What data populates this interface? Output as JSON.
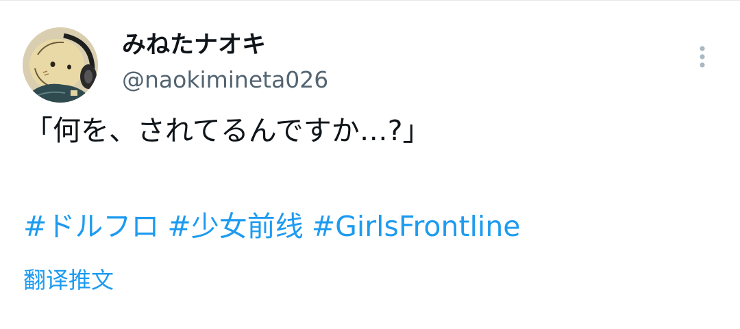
{
  "tweet": {
    "author": {
      "display_name": "みねたナオキ",
      "handle": "@naokimineta026",
      "avatar_icon": "avatar-character-with-headphones"
    },
    "text": "「何を、されてるんですか…?」",
    "hashtags": [
      "#ドルフロ",
      "#少女前线",
      "#GirlsFrontline"
    ],
    "translate_label": "翻译推文",
    "more_icon": "more-vertical-icon"
  },
  "colors": {
    "link": "#1d9bf0",
    "text_primary": "#0f1419",
    "text_secondary": "#536471",
    "icon_muted": "#aab8c2"
  }
}
